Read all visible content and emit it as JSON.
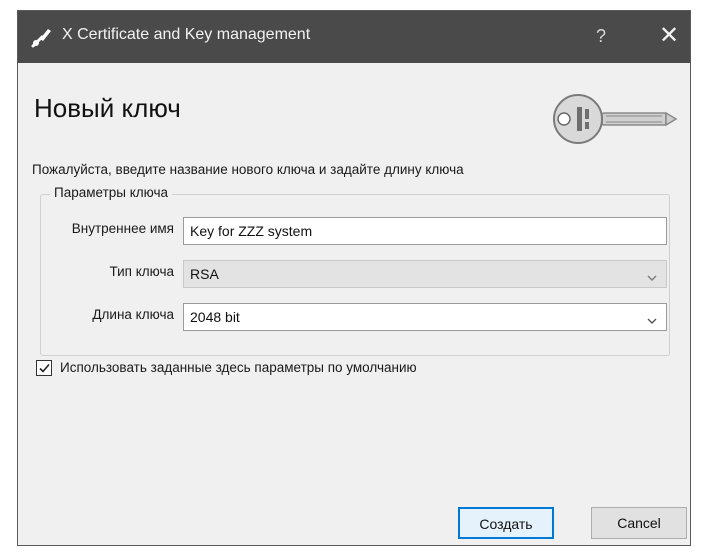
{
  "window": {
    "title": "X Certificate and Key management",
    "help_symbol": "?",
    "close_symbol": "✕",
    "app_icon": "key-pen-icon",
    "titlebar_color": "#4a4a4a"
  },
  "page": {
    "heading": "Новый ключ",
    "key_icon": "key-icon",
    "description": "Пожалуйста, введите название нового ключа и задайте длину ключа"
  },
  "group": {
    "title": "Параметры ключа",
    "fields": {
      "internal_name": {
        "label": "Внутреннее имя",
        "value": "Key for ZZZ system"
      },
      "key_type": {
        "label": "Тип ключа",
        "value": "RSA"
      },
      "key_length": {
        "label": "Длина ключа",
        "value": "2048 bit"
      }
    }
  },
  "defaults_checkbox": {
    "label": "Использовать заданные здесь параметры по умолчанию",
    "checked": true
  },
  "buttons": {
    "create": "Создать",
    "cancel": "Cancel",
    "accent": "#0078d7"
  }
}
